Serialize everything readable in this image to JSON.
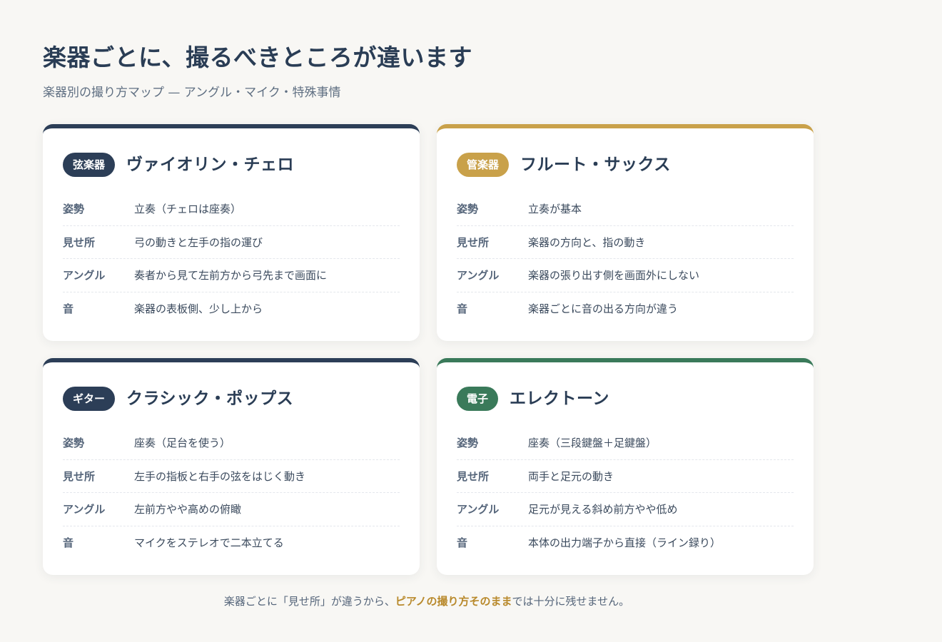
{
  "title": "楽器ごとに、撮るべきところが違います",
  "subtitle": "楽器別の撮り方マップ — アングル・マイク・特殊事情",
  "colors": {
    "navy": "#2c3e57",
    "gold": "#c9a14a",
    "green": "#3a7a5a",
    "highlight": "#b8892b"
  },
  "cards": [
    {
      "badge": "弦楽器",
      "title": "ヴァイオリン・チェロ",
      "accent": "#2c3e57",
      "rows": [
        {
          "label": "姿勢",
          "value": "立奏（チェロは座奏）"
        },
        {
          "label": "見せ所",
          "value": "弓の動きと左手の指の運び"
        },
        {
          "label": "アングル",
          "value": "奏者から見て左前方から弓先まで画面に"
        },
        {
          "label": "音",
          "value": "楽器の表板側、少し上から"
        }
      ]
    },
    {
      "badge": "管楽器",
      "title": "フルート・サックス",
      "accent": "#c9a14a",
      "rows": [
        {
          "label": "姿勢",
          "value": "立奏が基本"
        },
        {
          "label": "見せ所",
          "value": "楽器の方向と、指の動き"
        },
        {
          "label": "アングル",
          "value": "楽器の張り出す側を画面外にしない"
        },
        {
          "label": "音",
          "value": "楽器ごとに音の出る方向が違う"
        }
      ]
    },
    {
      "badge": "ギター",
      "title": "クラシック・ポップス",
      "accent": "#2c3e57",
      "rows": [
        {
          "label": "姿勢",
          "value": "座奏（足台を使う）"
        },
        {
          "label": "見せ所",
          "value": "左手の指板と右手の弦をはじく動き"
        },
        {
          "label": "アングル",
          "value": "左前方やや高めの俯瞰"
        },
        {
          "label": "音",
          "value": "マイクをステレオで二本立てる"
        }
      ]
    },
    {
      "badge": "電子",
      "title": "エレクトーン",
      "accent": "#3a7a5a",
      "rows": [
        {
          "label": "姿勢",
          "value": "座奏（三段鍵盤＋足鍵盤）"
        },
        {
          "label": "見せ所",
          "value": "両手と足元の動き"
        },
        {
          "label": "アングル",
          "value": "足元が見える斜め前方やや低め"
        },
        {
          "label": "音",
          "value": "本体の出力端子から直接（ライン録り）"
        }
      ]
    }
  ],
  "footer": {
    "before": "楽器ごとに「見せ所」が違うから、",
    "highlight": "ピアノの撮り方そのまま",
    "after": "では十分に残せません。"
  }
}
